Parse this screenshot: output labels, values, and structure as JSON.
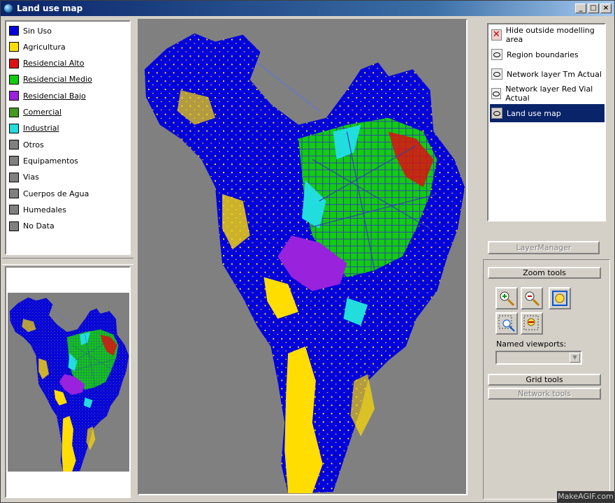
{
  "window": {
    "title": "Land use map",
    "buttons": [
      "_",
      "□",
      "×"
    ]
  },
  "legend": {
    "items": [
      {
        "label": "Sin Uso",
        "color": "#0000dd",
        "underlined": false
      },
      {
        "label": "Agricultura",
        "color": "#ffdd00",
        "underlined": false
      },
      {
        "label": "Residencial Alto",
        "color": "#dd1111",
        "underlined": true
      },
      {
        "label": "Residencial Medio",
        "color": "#11cc11",
        "underlined": true
      },
      {
        "label": "Residencial Bajo",
        "color": "#9922dd",
        "underlined": true
      },
      {
        "label": "Comercial",
        "color": "#449922",
        "underlined": true
      },
      {
        "label": "Industrial",
        "color": "#22dddd",
        "underlined": true
      },
      {
        "label": "Otros",
        "color": "#808080",
        "underlined": false
      },
      {
        "label": "Equipamentos",
        "color": "#808080",
        "underlined": false
      },
      {
        "label": "Vias",
        "color": "#808080",
        "underlined": false
      },
      {
        "label": "Cuerpos de Agua",
        "color": "#808080",
        "underlined": false
      },
      {
        "label": "Humedales",
        "color": "#808080",
        "underlined": false
      },
      {
        "label": "No Data",
        "color": "#808080",
        "underlined": false
      }
    ]
  },
  "layers": {
    "items": [
      {
        "label": "Hide outside modelling area",
        "icon": "hide-icon",
        "selected": false
      },
      {
        "label": "Region boundaries",
        "icon": "eye-icon",
        "selected": false
      },
      {
        "label": "Network layer Tm Actual",
        "icon": "eye-icon",
        "selected": false
      },
      {
        "label": "Network layer Red Vial Actual",
        "icon": "eye-icon",
        "selected": false
      },
      {
        "label": "Land use map",
        "icon": "eye-icon",
        "selected": true
      }
    ]
  },
  "layer_manager_label": "LayerManager",
  "zoom_tools": {
    "header": "Zoom tools",
    "buttons": [
      "zoom-in-icon",
      "zoom-out-icon",
      "zoom-extent-icon",
      "zoom-window-icon",
      "zoom-previous-icon"
    ],
    "named_viewports_label": "Named viewports:",
    "named_viewports_value": ""
  },
  "grid_tools_label": "Grid tools",
  "network_tools_label": "Network tools",
  "watermark": "MakeAGIF.com",
  "colors": {
    "sin_uso": "#0000dd",
    "agricultura": "#ffdd00",
    "background_map": "#808080",
    "selection": "#0a246a"
  }
}
